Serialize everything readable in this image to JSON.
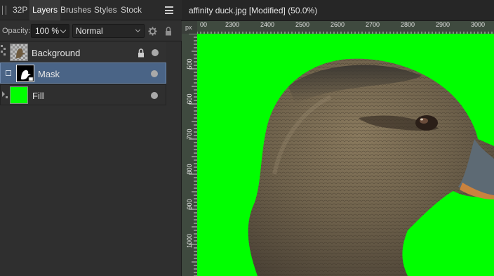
{
  "panel": {
    "tabs": [
      {
        "label": "32P"
      },
      {
        "label": "Layers"
      },
      {
        "label": "Brushes"
      },
      {
        "label": "Styles"
      },
      {
        "label": "Stock"
      }
    ],
    "active_tab": "Layers",
    "options": {
      "opacity_label": "Opacity:",
      "opacity_value": "100 %",
      "blend_mode": "Normal"
    },
    "layers": [
      {
        "name": "Background",
        "locked": true,
        "visible": true
      },
      {
        "name": "Mask",
        "selected": true,
        "visible": true
      },
      {
        "name": "Fill",
        "visible": true,
        "fill_color": "#00ff00"
      }
    ]
  },
  "document": {
    "title": "affinity duck.jpg [Modified] (50.0%)",
    "ruler_unit": "px",
    "ruler_top_labels": [
      "00",
      "2300",
      "2400",
      "2500",
      "2600",
      "2700",
      "2800",
      "2900",
      "3000"
    ],
    "ruler_left_labels": [
      "500",
      "600",
      "700",
      "800",
      "900",
      "1000"
    ],
    "background_color": "#00ff00"
  },
  "colors": {
    "accent_selected": "#4a6486",
    "canvas_green": "#00ff00"
  }
}
